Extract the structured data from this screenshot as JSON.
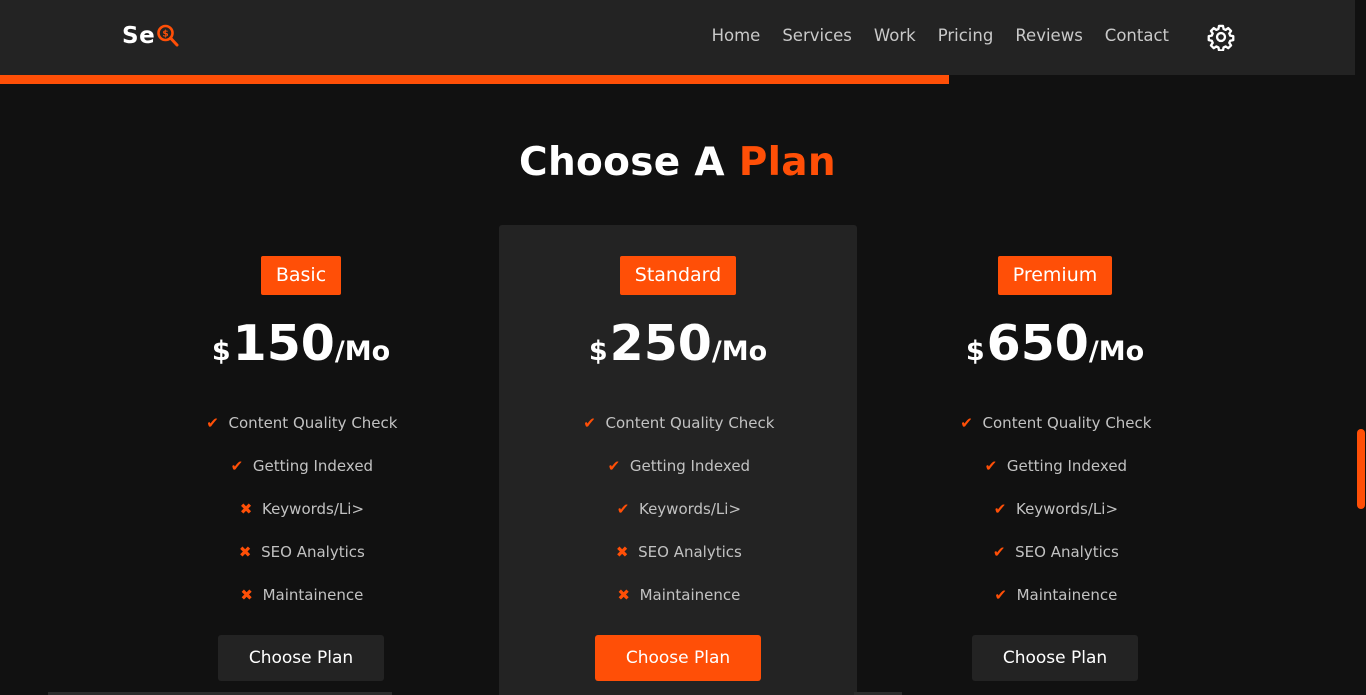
{
  "header": {
    "logo_text": "Se",
    "logo_icon": "magnifier-dollar-icon",
    "nav": [
      "Home",
      "Services",
      "Work",
      "Pricing",
      "Reviews",
      "Contact"
    ],
    "settings_icon": "gear-icon"
  },
  "scroll_progress": 0.7,
  "accent_color": "#ff4f07",
  "section": {
    "title_main": "Choose A",
    "title_accent": "Plan"
  },
  "plans": [
    {
      "name": "Basic",
      "currency": "$",
      "amount": "150",
      "period": "/Mo",
      "features": [
        {
          "label": "Content Quality Check",
          "included": true
        },
        {
          "label": "Getting Indexed",
          "included": true
        },
        {
          "label": "Keywords/Li>",
          "included": false
        },
        {
          "label": "SEO Analytics",
          "included": false
        },
        {
          "label": "Maintainence",
          "included": false
        }
      ],
      "button": "Choose Plan",
      "featured": false
    },
    {
      "name": "Standard",
      "currency": "$",
      "amount": "250",
      "period": "/Mo",
      "features": [
        {
          "label": "Content Quality Check",
          "included": true
        },
        {
          "label": "Getting Indexed",
          "included": true
        },
        {
          "label": "Keywords/Li>",
          "included": true
        },
        {
          "label": "SEO Analytics",
          "included": false
        },
        {
          "label": "Maintainence",
          "included": false
        }
      ],
      "button": "Choose Plan",
      "featured": true
    },
    {
      "name": "Premium",
      "currency": "$",
      "amount": "650",
      "period": "/Mo",
      "features": [
        {
          "label": "Content Quality Check",
          "included": true
        },
        {
          "label": "Getting Indexed",
          "included": true
        },
        {
          "label": "Keywords/Li>",
          "included": true
        },
        {
          "label": "SEO Analytics",
          "included": true
        },
        {
          "label": "Maintainence",
          "included": true
        }
      ],
      "button": "Choose Plan",
      "featured": false
    }
  ]
}
